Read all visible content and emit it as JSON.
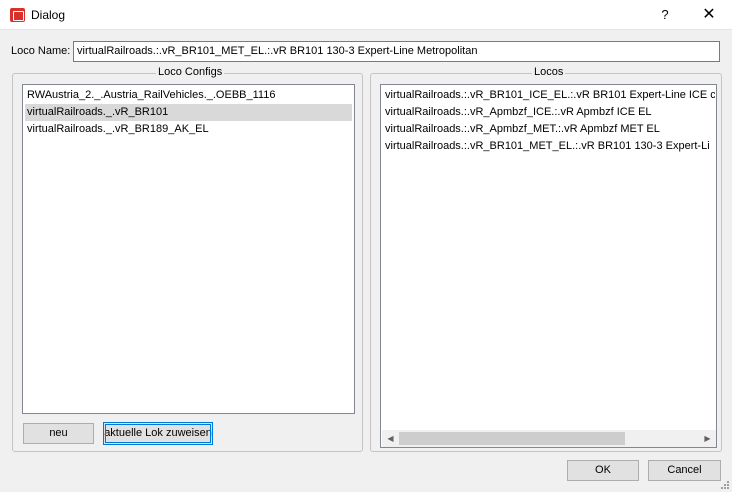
{
  "window": {
    "title": "Dialog",
    "help_label": "?",
    "close_label": "✕"
  },
  "loco_name": {
    "label": "Loco Name:",
    "value": "virtualRailroads.:.vR_BR101_MET_EL.:.vR BR101 130-3 Expert-Line Metropolitan"
  },
  "loco_configs": {
    "title": "Loco Configs",
    "items": [
      "RWAustria_2._.Austria_RailVehicles._.OEBB_1116",
      "virtualRailroads._.vR_BR101",
      "virtualRailroads._.vR_BR189_AK_EL"
    ],
    "selected_index": 1,
    "new_button": "neu",
    "assign_button": "aktuelle Lok zuweisen"
  },
  "locos": {
    "title": "Locos",
    "items": [
      "virtualRailroads.:.vR_BR101_ICE_EL.:.vR BR101 Expert-Line ICE c",
      "virtualRailroads.:.vR_Apmbzf_ICE.:.vR Apmbzf ICE EL",
      "virtualRailroads.:.vR_Apmbzf_MET.:.vR Apmbzf MET EL",
      "virtualRailroads.:.vR_BR101_MET_EL.:.vR BR101 130-3 Expert-Li"
    ],
    "scroll_left_icon": "◀",
    "scroll_right_icon": "▶"
  },
  "footer": {
    "ok_button": "OK",
    "cancel_button": "Cancel"
  },
  "colors": {
    "focus_blue": "#0078d7",
    "selection_gray": "#d9d9d9",
    "icon_red": "#d9302c"
  }
}
